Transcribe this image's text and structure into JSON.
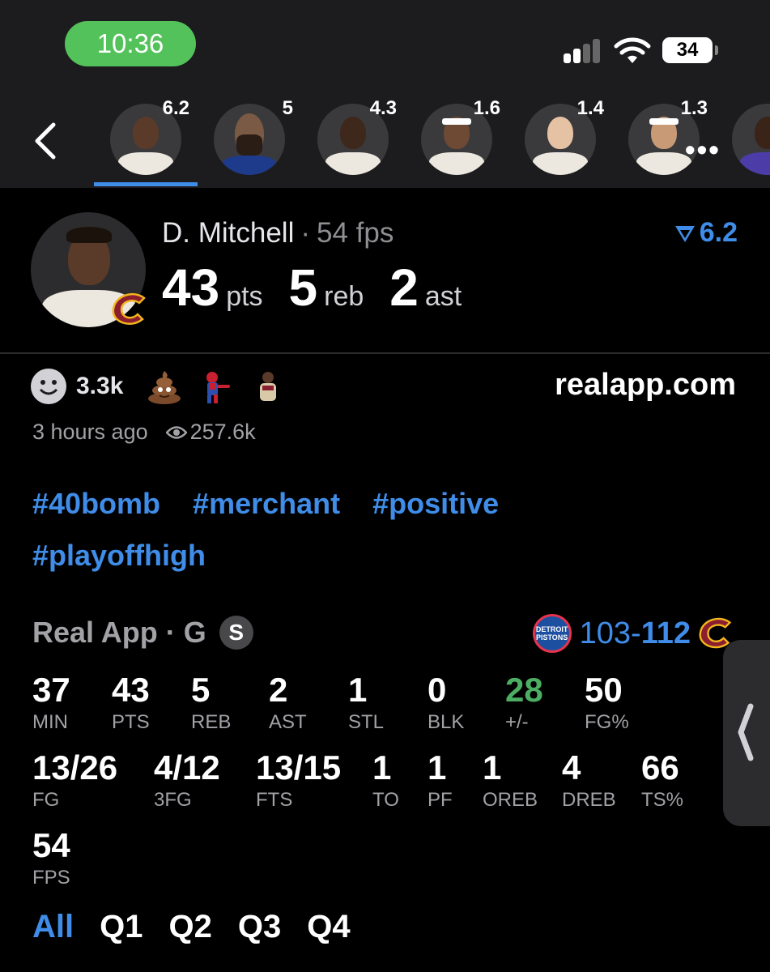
{
  "status_bar": {
    "time": "10:36",
    "battery": "34"
  },
  "header": {
    "roster": [
      {
        "rating": "6.2",
        "active": true
      },
      {
        "rating": "5",
        "active": false
      },
      {
        "rating": "4.3",
        "active": false
      },
      {
        "rating": "1.6",
        "active": false
      },
      {
        "rating": "1.4",
        "active": false
      },
      {
        "rating": "1.3",
        "active": false
      }
    ],
    "more": "•••"
  },
  "player": {
    "name": "D. Mitchell",
    "separator": "·",
    "fps": "54 fps",
    "rating": "6.2",
    "pts": "43",
    "pts_label": "pts",
    "reb": "5",
    "reb_label": "reb",
    "ast": "2",
    "ast_label": "ast"
  },
  "reactions": {
    "count": "3.3k",
    "site": "realapp.com"
  },
  "meta": {
    "time_ago": "3 hours ago",
    "views": "257.6k"
  },
  "hashtags": [
    "#40bomb",
    "#merchant",
    "#positive",
    "#playoffhigh"
  ],
  "game": {
    "label": "Real App",
    "separator": "·",
    "position": "G",
    "badge": "S",
    "opponent_logo_text": "DETROIT PISTONS",
    "score_left": "103",
    "score_dash": "-",
    "score_right": "112"
  },
  "stats": [
    {
      "value": "37",
      "label": "MIN"
    },
    {
      "value": "43",
      "label": "PTS"
    },
    {
      "value": "5",
      "label": "REB"
    },
    {
      "value": "2",
      "label": "AST"
    },
    {
      "value": "1",
      "label": "STL"
    },
    {
      "value": "0",
      "label": "BLK"
    },
    {
      "value": "28",
      "label": "+/-",
      "color": "#4cae63"
    },
    {
      "value": "50",
      "label": "FG%"
    },
    {
      "value": "13/26",
      "label": "FG"
    },
    {
      "value": "4/12",
      "label": "3FG"
    },
    {
      "value": "13/15",
      "label": "FTS"
    },
    {
      "value": "1",
      "label": "TO"
    },
    {
      "value": "1",
      "label": "PF"
    },
    {
      "value": "1",
      "label": "OREB"
    },
    {
      "value": "4",
      "label": "DREB"
    },
    {
      "value": "66",
      "label": "TS%"
    },
    {
      "value": "54",
      "label": "FPS"
    }
  ],
  "quarters": [
    {
      "label": "All",
      "active": true
    },
    {
      "label": "Q1",
      "active": false
    },
    {
      "label": "Q2",
      "active": false
    },
    {
      "label": "Q3",
      "active": false
    },
    {
      "label": "Q4",
      "active": false
    }
  ],
  "colors": {
    "accent": "#3f8de8",
    "positive": "#4cae63",
    "status_green": "#54c25a"
  }
}
